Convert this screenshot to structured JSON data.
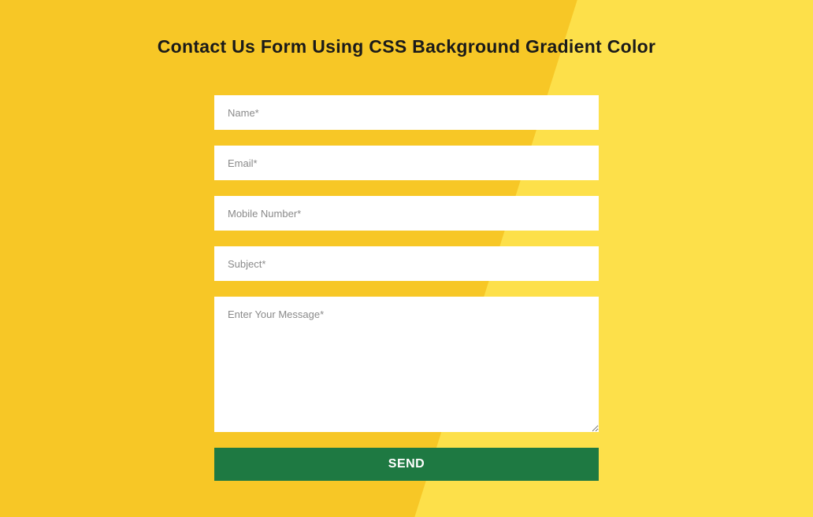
{
  "page": {
    "title": "Contact Us Form Using CSS Background Gradient Color"
  },
  "form": {
    "fields": {
      "name": {
        "placeholder": "Name*",
        "value": ""
      },
      "email": {
        "placeholder": "Email*",
        "value": ""
      },
      "mobile": {
        "placeholder": "Mobile Number*",
        "value": ""
      },
      "subject": {
        "placeholder": "Subject*",
        "value": ""
      },
      "message": {
        "placeholder": "Enter Your Message*",
        "value": ""
      }
    },
    "submit_label": "SEND"
  },
  "colors": {
    "bg_left": "#f7c726",
    "bg_right": "#fde04a",
    "button": "#1e7942",
    "button_text": "#ffffff",
    "field_bg": "#ffffff"
  }
}
